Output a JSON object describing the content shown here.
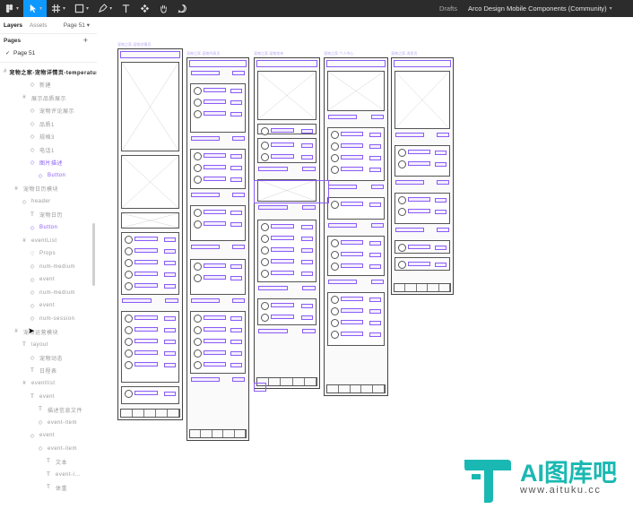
{
  "toolbar": {
    "tools": [
      {
        "name": "main-menu",
        "icon": "figma-logo-icon",
        "active": false
      },
      {
        "name": "move",
        "icon": "cursor-arrow-icon",
        "active": true
      },
      {
        "name": "frame",
        "icon": "frame-hash-icon",
        "active": false
      },
      {
        "name": "shape",
        "icon": "rectangle-icon",
        "active": false
      },
      {
        "name": "pen",
        "icon": "pen-icon",
        "active": false
      },
      {
        "name": "text",
        "icon": "text-t-icon",
        "active": false
      },
      {
        "name": "resources",
        "icon": "components-icon",
        "active": false
      },
      {
        "name": "hand",
        "icon": "hand-icon",
        "active": false
      },
      {
        "name": "comment",
        "icon": "comment-icon",
        "active": false
      }
    ],
    "location": "Drafts",
    "file_name": "Arco Design Mobile Components (Community)"
  },
  "panel": {
    "tabs": [
      "Layers",
      "Assets"
    ],
    "page_selector": "Page 51",
    "pages_header": "Pages",
    "current_page": "Page 51",
    "layers": [
      {
        "indent": 0,
        "icon": "frame",
        "label": "宠物之家-宠物详情页-temperature...",
        "top": true,
        "purple": false
      },
      {
        "indent": 3,
        "icon": "instance",
        "label": "新建",
        "top": false,
        "purple": false
      },
      {
        "indent": 2,
        "icon": "frame",
        "label": "展示品质展示",
        "top": false,
        "purple": false
      },
      {
        "indent": 3,
        "icon": "instance",
        "label": "宠物评论展示",
        "top": false,
        "purple": false
      },
      {
        "indent": 3,
        "icon": "instance",
        "label": "品质1",
        "top": false,
        "purple": false
      },
      {
        "indent": 3,
        "icon": "instance",
        "label": "规格3",
        "top": false,
        "purple": false
      },
      {
        "indent": 3,
        "icon": "instance",
        "label": "电话1",
        "top": false,
        "purple": false
      },
      {
        "indent": 3,
        "icon": "instance",
        "label": "图片描述",
        "top": false,
        "purple": true
      },
      {
        "indent": 4,
        "icon": "instance",
        "label": "Button",
        "top": false,
        "purple": true
      },
      {
        "indent": 1,
        "icon": "frame",
        "label": "宠物日历模块",
        "top": false,
        "purple": false
      },
      {
        "indent": 2,
        "icon": "instance",
        "label": "header",
        "top": false,
        "purple": false
      },
      {
        "indent": 3,
        "icon": "text",
        "label": "宠物日历",
        "top": false,
        "purple": false
      },
      {
        "indent": 3,
        "icon": "instance",
        "label": "Button",
        "top": false,
        "purple": true
      },
      {
        "indent": 2,
        "icon": "frame",
        "label": "eventList",
        "top": false,
        "purple": false
      },
      {
        "indent": 3,
        "icon": "heart",
        "label": "Props",
        "top": false,
        "purple": false
      },
      {
        "indent": 3,
        "icon": "instance",
        "label": "num-medium",
        "top": false,
        "purple": false
      },
      {
        "indent": 3,
        "icon": "instance",
        "label": "event",
        "top": false,
        "purple": false
      },
      {
        "indent": 3,
        "icon": "instance",
        "label": "num-medium",
        "top": false,
        "purple": false
      },
      {
        "indent": 3,
        "icon": "instance",
        "label": "event",
        "top": false,
        "purple": false
      },
      {
        "indent": 3,
        "icon": "instance",
        "label": "num-session",
        "top": false,
        "purple": false
      },
      {
        "indent": 1,
        "icon": "frame",
        "label": "宠物运营模块",
        "top": false,
        "purple": false
      },
      {
        "indent": 2,
        "icon": "text",
        "label": "layout",
        "top": false,
        "purple": false
      },
      {
        "indent": 3,
        "icon": "instance",
        "label": "宠物动态",
        "top": false,
        "purple": false
      },
      {
        "indent": 3,
        "icon": "text",
        "label": "日程表",
        "top": false,
        "purple": false
      },
      {
        "indent": 2,
        "icon": "frame",
        "label": "eventlist",
        "top": false,
        "purple": false
      },
      {
        "indent": 3,
        "icon": "text",
        "label": "event",
        "top": false,
        "purple": false
      },
      {
        "indent": 4,
        "icon": "text",
        "label": "描述信息文件",
        "top": false,
        "purple": false
      },
      {
        "indent": 4,
        "icon": "instance",
        "label": "event-item",
        "top": false,
        "purple": false
      },
      {
        "indent": 3,
        "icon": "instance",
        "label": "event",
        "top": false,
        "purple": false
      },
      {
        "indent": 4,
        "icon": "instance",
        "label": "event-item",
        "top": false,
        "purple": false
      },
      {
        "indent": 5,
        "icon": "text",
        "label": "文本",
        "top": false,
        "purple": false
      },
      {
        "indent": 5,
        "icon": "text",
        "label": "event-i...",
        "top": false,
        "purple": false
      },
      {
        "indent": 5,
        "icon": "text",
        "label": "体重",
        "top": false,
        "purple": false
      }
    ]
  },
  "canvas": {
    "frame_labels": [
      "宠物之家-宠物详情页",
      "宠物之家-宠物列表页",
      "宠物之家-宠物发布",
      "宠物之家-个人中心",
      "宠物之家-消息页"
    ],
    "header_title": "Header Title",
    "accent_color": "#8a5cf6"
  },
  "watermark": {
    "brand": "AI图库吧",
    "url": "www.aituku.cc",
    "color": "#1ab8b2"
  }
}
